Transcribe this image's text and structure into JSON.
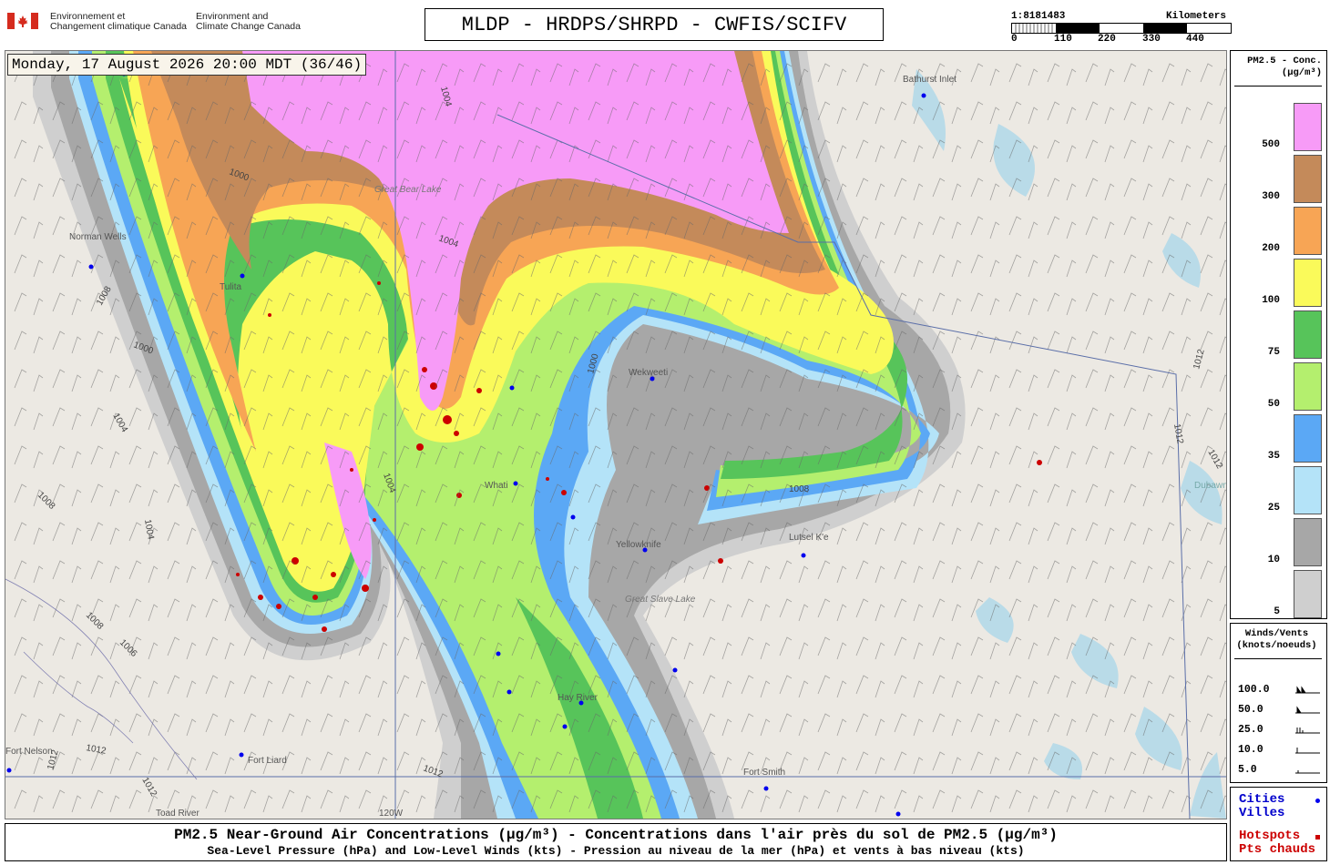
{
  "header": {
    "agency_fr_1": "Environnement et",
    "agency_fr_2": "Changement climatique Canada",
    "agency_en_1": "Environment and",
    "agency_en_2": "Climate Change Canada",
    "title": "MLDP - HRDPS/SHRPD - CWFIS/SCIFV"
  },
  "scale": {
    "ratio": "1:8181483",
    "units": "Kilometers",
    "ticks": [
      "0",
      "110",
      "220",
      "330",
      "440"
    ]
  },
  "map": {
    "timestamp": "Monday, 17 August 2026 20:00 MDT (36/46)",
    "places": [
      "Bathurst Inlet",
      "Norman Wells",
      "Tulita",
      "Great Bear Lake",
      "Wekweeti",
      "Whati",
      "Yellowknife",
      "Great Slave Lake",
      "Lutsel K'e",
      "Hay River",
      "Fort Smith",
      "Fort Liard",
      "Fort Nelson",
      "Toad River",
      "Dubawnt Lake",
      "120W"
    ],
    "isobars": [
      "1004",
      "1004",
      "1000",
      "1000",
      "1000",
      "1004",
      "1004",
      "1008",
      "1004",
      "1008",
      "1006",
      "1008",
      "1012",
      "1012",
      "1012",
      "1012",
      "1008",
      "1012",
      "1012",
      "1012"
    ]
  },
  "legend": {
    "title_1": "PM2.5 - Conc.",
    "title_2": "(µg/m³)",
    "items": [
      {
        "label": "500",
        "color": "#f79bf7"
      },
      {
        "label": "300",
        "color": "#c48a5a"
      },
      {
        "label": "200",
        "color": "#f7a555"
      },
      {
        "label": "100",
        "color": "#fafa5a"
      },
      {
        "label": "75",
        "color": "#57c45a"
      },
      {
        "label": "50",
        "color": "#b4ef6e"
      },
      {
        "label": "35",
        "color": "#5ba8f5"
      },
      {
        "label": "25",
        "color": "#b4e3f8"
      },
      {
        "label": "10",
        "color": "#a7a7a7"
      },
      {
        "label": "5",
        "color": "#cfcfcf"
      }
    ]
  },
  "wind_legend": {
    "title_1": "Winds/Vents",
    "title_2": "(knots/noeuds)",
    "items": [
      "100.0",
      "50.0",
      "25.0",
      "10.0",
      "5.0"
    ]
  },
  "symbols": {
    "cities_en": "Cities",
    "cities_fr": "Villes",
    "hotspots_en": "Hotspots",
    "hotspots_fr": "Pts chauds",
    "city_color": "#0000ee",
    "hotspot_color": "#cc0000"
  },
  "footer": {
    "line1": "PM2.5 Near-Ground Air Concentrations (µg/m³) - Concentrations dans l'air près du sol de PM2.5 (µg/m³)",
    "line2": "Sea-Level Pressure (hPa) and Low-Level Winds (kts) - Pression au niveau de la mer (hPa) et vents à bas niveau (kts)"
  }
}
